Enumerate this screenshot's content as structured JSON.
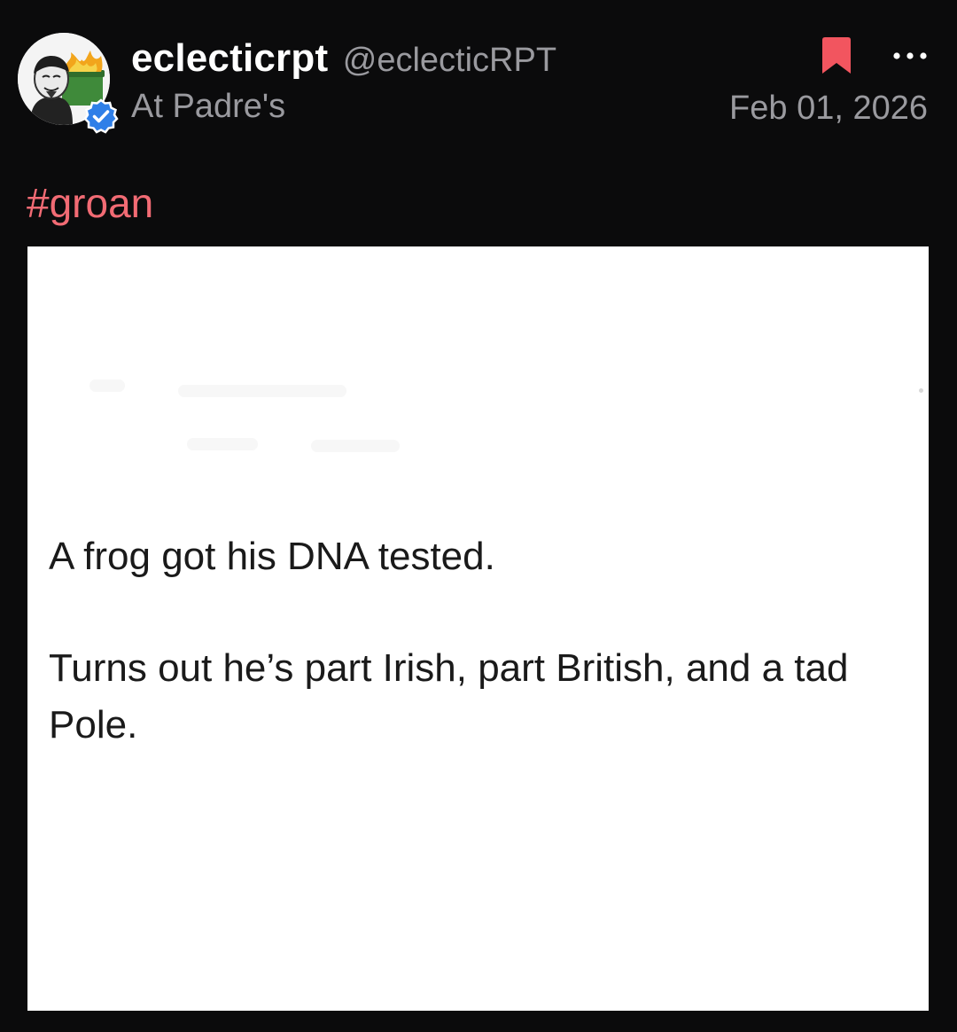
{
  "author": {
    "display_name": "eclecticrpt",
    "username": "@eclecticRPT",
    "location": "At Padre's",
    "verified": true,
    "avatar_icon": "avatar-masked-figure-dumpster-fire"
  },
  "post": {
    "date": "Feb 01, 2026",
    "hashtag": "#groan"
  },
  "actions": {
    "bookmark_icon": "bookmark-icon",
    "more_icon": "more-horizontal-icon"
  },
  "media": {
    "line_1": "A frog got his DNA tested.",
    "line_2": "Turns out he’s part Irish, part British, and a tad Pole."
  },
  "colors": {
    "background": "#0b0b0c",
    "hashtag": "#f26b74",
    "bookmark": "#f2555f",
    "verified": "#2f7fe8",
    "muted_text": "#9a9a9f"
  }
}
